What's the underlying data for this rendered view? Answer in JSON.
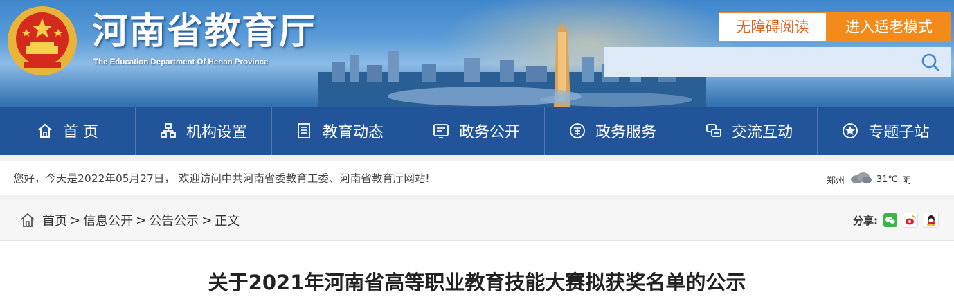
{
  "header": {
    "site_title": "河南省教育厅",
    "site_subtitle": "The Education Department Of Henan Province",
    "accessibility_label": "无障碍阅读",
    "elder_mode_label": "进入适老模式",
    "search_placeholder": ""
  },
  "nav": {
    "items": [
      {
        "label": "首 页",
        "icon": "home-icon"
      },
      {
        "label": "机构设置",
        "icon": "org-icon"
      },
      {
        "label": "教育动态",
        "icon": "news-icon"
      },
      {
        "label": "政务公开",
        "icon": "gov-open-icon"
      },
      {
        "label": "政务服务",
        "icon": "gov-service-icon"
      },
      {
        "label": "交流互动",
        "icon": "interaction-icon"
      },
      {
        "label": "专题子站",
        "icon": "topic-icon"
      }
    ]
  },
  "welcome": {
    "text": "您好，今天是2022年05月27日， 欢迎访问中共河南省委教育工委、河南省教育厅网站!",
    "city": "郑州",
    "temperature": "31℃",
    "condition": "阴"
  },
  "breadcrumb": {
    "items": [
      "首页",
      "信息公开",
      "公告公示"
    ],
    "current": "正文",
    "share_label": "分享:"
  },
  "article": {
    "title": "关于2021年河南省高等职业教育技能大赛拟获奖名单的公示"
  },
  "colors": {
    "nav_bg": "#225499",
    "accent_orange": "#f38b1b",
    "banner_blue": "#3f86cc"
  }
}
